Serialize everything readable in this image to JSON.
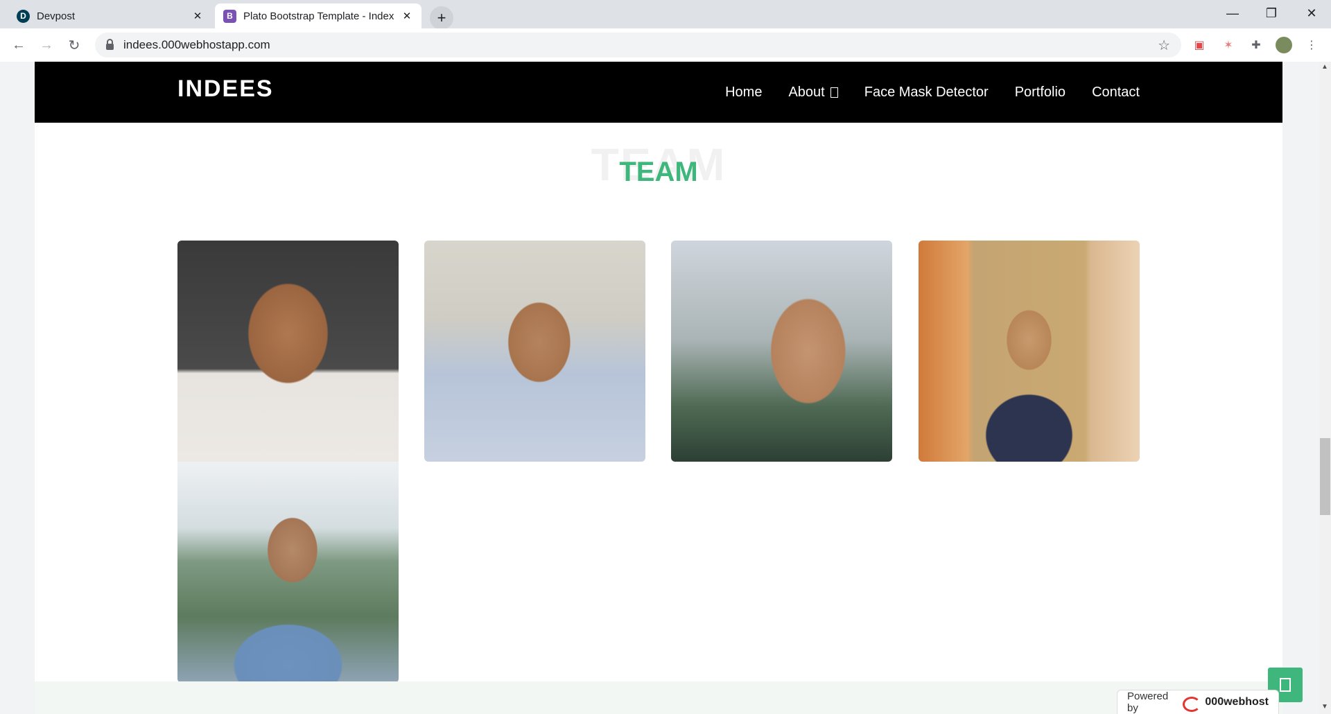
{
  "browser": {
    "tabs": [
      {
        "title": "Devpost",
        "favicon": "D",
        "active": false
      },
      {
        "title": "Plato Bootstrap Template - Index",
        "favicon": "B",
        "active": true
      }
    ],
    "url": "indees.000webhostapp.com"
  },
  "site": {
    "brand": "INDEES",
    "menu": [
      {
        "label": "Home"
      },
      {
        "label": "About"
      },
      {
        "label": "Face Mask Detector"
      },
      {
        "label": "Portfolio"
      },
      {
        "label": "Contact"
      }
    ],
    "team_section": {
      "ghost_title": "TEAM",
      "title": "TEAM",
      "accent_color": "#3fb77c",
      "members": [
        {
          "name": "team-member-1"
        },
        {
          "name": "team-member-2"
        },
        {
          "name": "team-member-3"
        },
        {
          "name": "team-member-4"
        },
        {
          "name": "team-member-5"
        }
      ]
    }
  },
  "badge": {
    "powered_by": "Powered by",
    "host_name": "000webhost"
  }
}
